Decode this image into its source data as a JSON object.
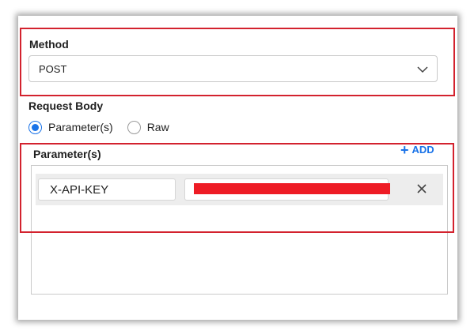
{
  "method": {
    "label": "Method",
    "selected": "POST"
  },
  "request_body": {
    "label": "Request Body",
    "options": [
      {
        "label": "Parameter(s)",
        "checked": true
      },
      {
        "label": "Raw",
        "checked": false
      }
    ]
  },
  "parameters": {
    "label": "Parameter(s)",
    "add_label": "ADD",
    "rows": [
      {
        "key": "X-API-KEY",
        "value": ""
      }
    ]
  },
  "colors": {
    "accent": "#1a73e8",
    "annotation": "#d3222e",
    "redaction": "#ee1c25"
  },
  "icons": {
    "dropdown": "chevron-down-icon",
    "add": "plus-icon",
    "remove": "close-icon"
  }
}
